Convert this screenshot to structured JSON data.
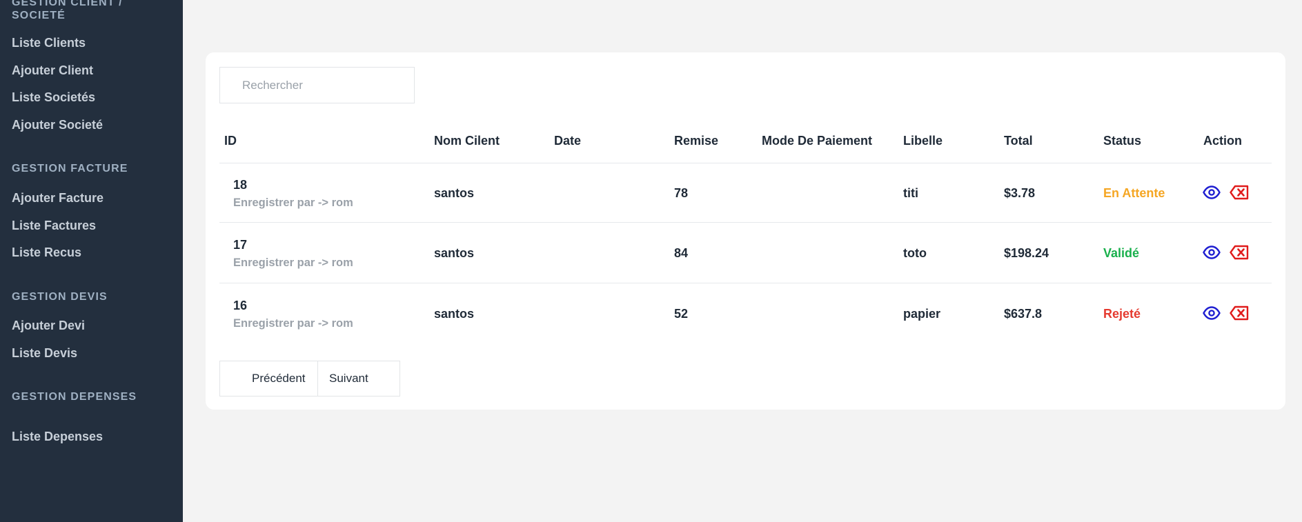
{
  "sidebar": {
    "sections": [
      {
        "title_line1": "GESTION CLIENT /",
        "title_line2": "SOCIETÉ"
      },
      {
        "title": "GESTION FACTURE"
      },
      {
        "title": "GESTION DEVIS"
      },
      {
        "title": "GESTION DEPENSES"
      }
    ],
    "items": [
      {
        "label": "Liste Clients"
      },
      {
        "label": "Ajouter Client"
      },
      {
        "label": "Liste Societés"
      },
      {
        "label": "Ajouter Societé"
      },
      {
        "label": "Ajouter Facture"
      },
      {
        "label": "Liste Factures"
      },
      {
        "label": "Liste Recus"
      },
      {
        "label": "Ajouter Devi"
      },
      {
        "label": "Liste Devis"
      },
      {
        "label": "Liste Depenses"
      }
    ]
  },
  "search": {
    "placeholder": "Rechercher"
  },
  "table": {
    "headers": [
      "ID",
      "Nom Cilent",
      "Date",
      "Remise",
      "Mode De Paiement",
      "Libelle",
      "Total",
      "Status",
      "Action"
    ],
    "rows": [
      {
        "id": "18",
        "recorded_by": "Enregistrer par -> rom",
        "client": "santos",
        "date": "",
        "remise": "78",
        "mode": "",
        "libelle": "titi",
        "total": "$3.78",
        "status": "En Attente"
      },
      {
        "id": "17",
        "recorded_by": "Enregistrer par -> rom",
        "client": "santos",
        "date": "",
        "remise": "84",
        "mode": "",
        "libelle": "toto",
        "total": "$198.24",
        "status": "Validé"
      },
      {
        "id": "16",
        "recorded_by": "Enregistrer par -> rom",
        "client": "santos",
        "date": "",
        "remise": "52",
        "mode": "",
        "libelle": "papier",
        "total": "$637.8",
        "status": "Rejeté"
      }
    ]
  },
  "pagination": {
    "prev_label": "Précédent",
    "next_label": "Suivant"
  },
  "colors": {
    "sidebar_bg": "#232f3e",
    "status_pending": "#f5a623",
    "status_valid": "#19b04c",
    "status_reject": "#e53a2f",
    "view_icon": "#1f1fd1",
    "delete_icon": "#e01b1b"
  },
  "icons": {
    "view": "eye-icon",
    "delete": "delete-x-icon"
  }
}
